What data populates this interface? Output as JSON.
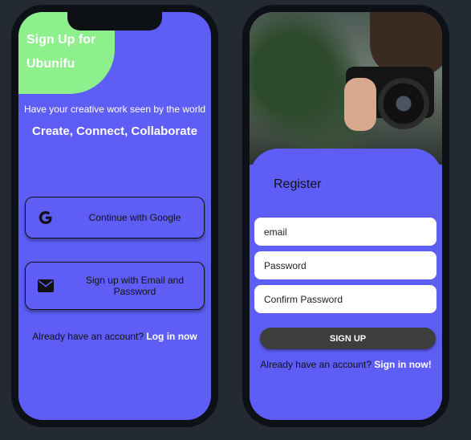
{
  "signup_screen": {
    "title": "Sign Up for Ubunifu",
    "tagline": "Have your creative work seen by the world",
    "headline": "Create, Connect, Collaborate",
    "google_button": "Continue with Google",
    "email_button": "Sign up with Email and Password",
    "login_prompt": "Already have an account?",
    "login_link": "Log in now",
    "accent_color": "#5e5ef7",
    "blob_color": "#8ef08d"
  },
  "register_screen": {
    "title": "Register",
    "email_placeholder": "email",
    "password_placeholder": "Password",
    "confirm_placeholder": "Confirm Password",
    "submit_label": "SIGN UP",
    "signin_prompt": "Already have an account?",
    "signin_link": "Sign in now!",
    "image": "photographer-with-camera-photo"
  }
}
